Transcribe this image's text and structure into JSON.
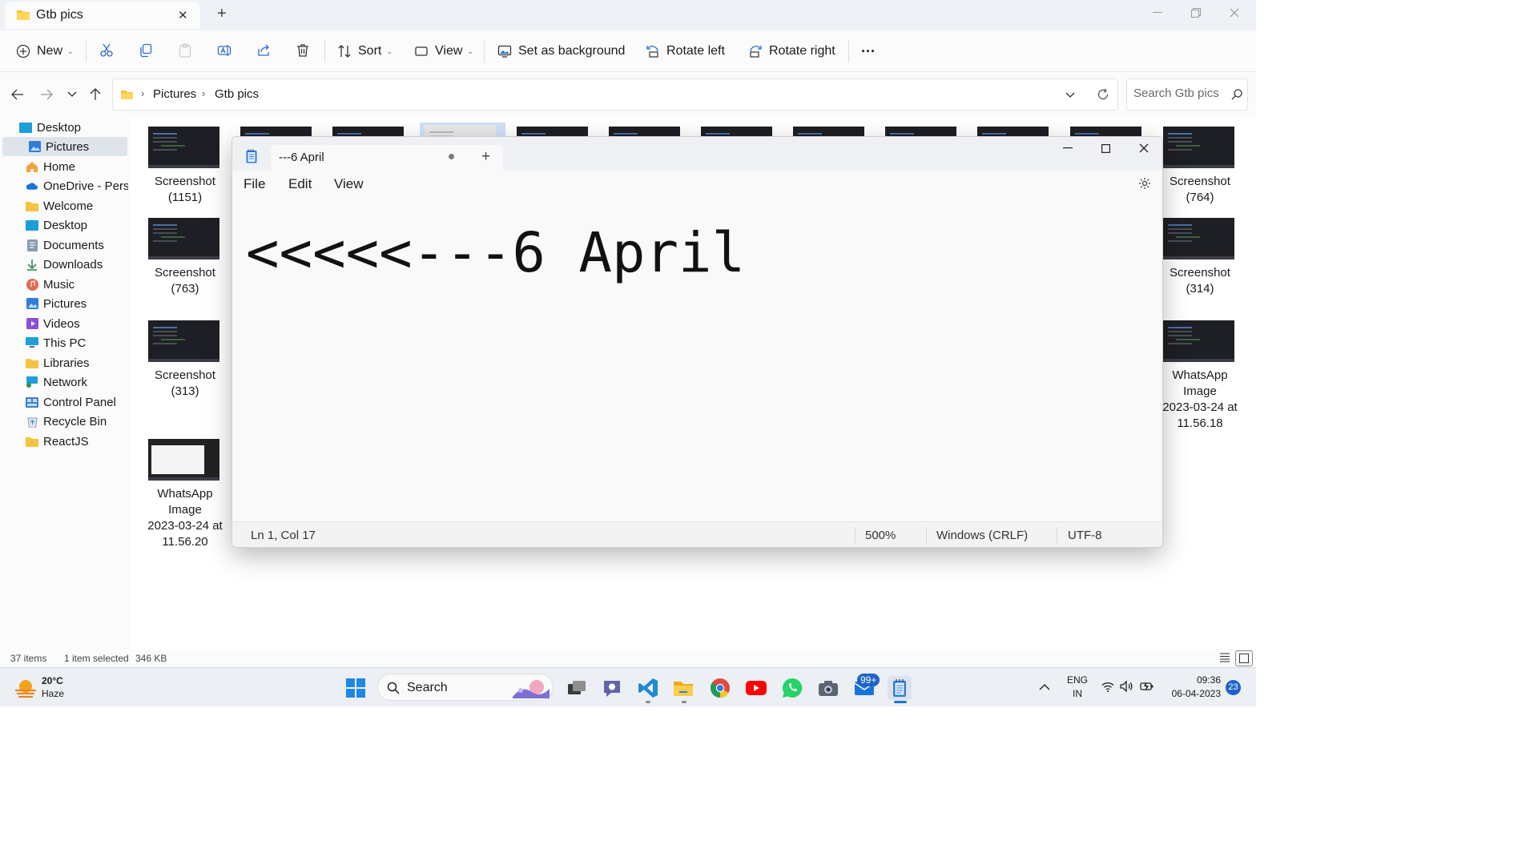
{
  "explorer": {
    "tab_title": "Gtb pics",
    "toolbar": {
      "new_label": "New",
      "sort_label": "Sort",
      "view_label": "View",
      "set_background_label": "Set as background",
      "rotate_left_label": "Rotate left",
      "rotate_right_label": "Rotate right",
      "more_label": "···"
    },
    "breadcrumb": [
      "Pictures",
      "Gtb pics"
    ],
    "search_placeholder": "Search Gtb pics",
    "nav_items": [
      {
        "label": "Desktop",
        "icon": "desktop-icon"
      },
      {
        "label": "Pictures",
        "icon": "pictures-icon",
        "selected": true
      },
      {
        "label": "Home",
        "icon": "home-icon"
      },
      {
        "label": "OneDrive - Persc",
        "icon": "onedrive-icon"
      },
      {
        "label": "Welcome",
        "icon": "folder-icon"
      },
      {
        "label": "Desktop",
        "icon": "desktop-icon"
      },
      {
        "label": "Documents",
        "icon": "documents-icon"
      },
      {
        "label": "Downloads",
        "icon": "downloads-icon"
      },
      {
        "label": "Music",
        "icon": "music-icon"
      },
      {
        "label": "Pictures",
        "icon": "pictures-icon"
      },
      {
        "label": "Videos",
        "icon": "videos-icon"
      },
      {
        "label": "This PC",
        "icon": "pc-icon"
      },
      {
        "label": "Libraries",
        "icon": "folder-icon"
      },
      {
        "label": "Network",
        "icon": "network-icon"
      },
      {
        "label": "Control Panel",
        "icon": "control-panel-icon"
      },
      {
        "label": "Recycle Bin",
        "icon": "recycle-bin-icon"
      },
      {
        "label": "ReactJS",
        "icon": "folder-icon"
      }
    ],
    "files_left": [
      {
        "name_line1": "Screenshot",
        "name_line2": "(1151)"
      },
      {
        "name_line1": "Screenshot",
        "name_line2": "(763)"
      },
      {
        "name_line1": "Screenshot",
        "name_line2": "(313)"
      },
      {
        "name_line1": "WhatsApp",
        "name_line2": "Image",
        "name_line3": "2023-03-24 at",
        "name_line4": "11.56.20"
      }
    ],
    "files_right": [
      {
        "name_line1": "Screenshot",
        "name_line2": "(764)"
      },
      {
        "name_line1": "Screenshot",
        "name_line2": "(314)"
      },
      {
        "name_line1": "WhatsApp",
        "name_line2": "Image",
        "name_line3": "2023-03-24 at",
        "name_line4": "11.56.18"
      }
    ],
    "status": {
      "item_count": "37 items",
      "selection": "1 item selected",
      "selection_size": "346 KB"
    }
  },
  "notepad": {
    "tab_title": "---6 April",
    "menu": [
      "File",
      "Edit",
      "View"
    ],
    "content": "<<<<<---6 April",
    "status": {
      "position": "Ln 1, Col 17",
      "zoom": "500%",
      "line_ending": "Windows (CRLF)",
      "encoding": "UTF-8"
    }
  },
  "taskbar": {
    "weather_temp": "20°C",
    "weather_desc": "Haze",
    "search_label": "Search",
    "mail_badge": "99+",
    "language_line1": "ENG",
    "language_line2": "IN",
    "time": "09:36",
    "date": "06-04-2023",
    "notification_count": "23"
  },
  "colors": {
    "accent": "#0067c0",
    "nav_selected_bg": "#dfe3ea",
    "folder_yellow": "#f5c342"
  }
}
